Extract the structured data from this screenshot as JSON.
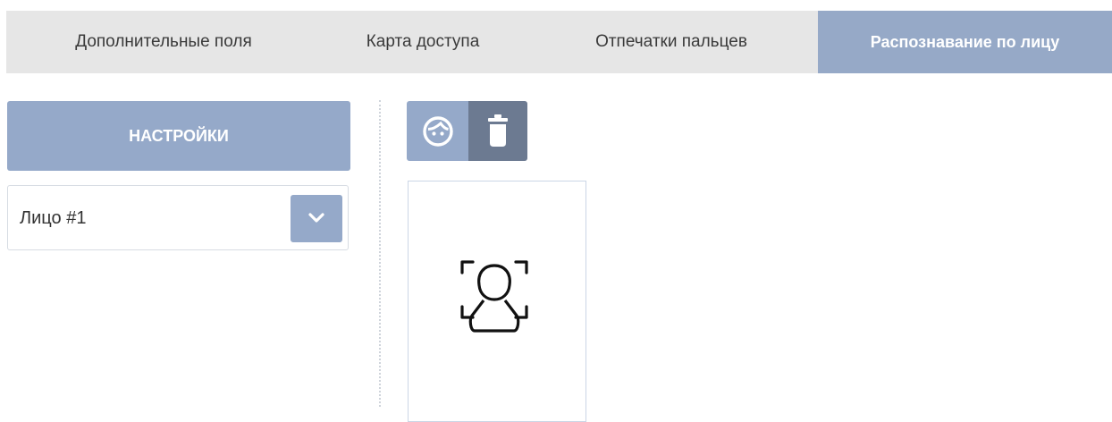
{
  "tabs": [
    {
      "label": "Дополнительные поля",
      "active": false
    },
    {
      "label": "Карта доступа",
      "active": false
    },
    {
      "label": "Отпечатки пальцев",
      "active": false
    },
    {
      "label": "Распознавание по лицу",
      "active": true
    }
  ],
  "settings_button": {
    "label": "НАСТРОЙКИ"
  },
  "face_select": {
    "value": "Лицо #1",
    "icon": "chevron-down-icon"
  },
  "toolbar": {
    "face_button_icon": "face-icon",
    "delete_button_icon": "trash-icon"
  },
  "face_card": {
    "icon": "face-recognition-icon"
  },
  "colors": {
    "accent": "#95a9c9",
    "accent_dark": "#6c7a91",
    "tabbar_bg": "#e6e6e6"
  }
}
